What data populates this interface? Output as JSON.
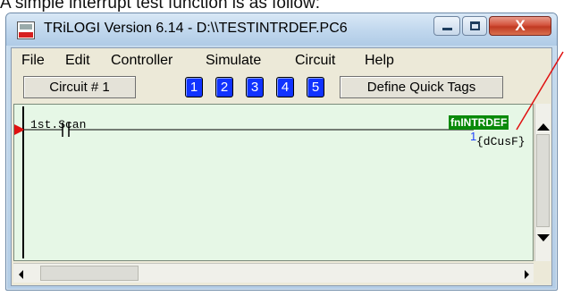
{
  "caption": "A simple interrupt test function is as follow:",
  "window": {
    "title": "TRiLOGI Version 6.14 - D:\\\\TESTINTRDEF.PC6",
    "minimize_icon": "minimize-icon",
    "maximize_icon": "maximize-icon",
    "close_icon": "close-icon",
    "close_glyph": "X"
  },
  "menu": {
    "items": [
      "File",
      "Edit",
      "Controller",
      "Simulate",
      "Circuit",
      "Help"
    ]
  },
  "toolbar": {
    "circuit_label": "Circuit # 1",
    "number_buttons": [
      "1",
      "2",
      "3",
      "4",
      "5"
    ],
    "define_label": "Define Quick Tags"
  },
  "ladder": {
    "contact_label": "1st.Scan",
    "function_name": "fnINTRDEF",
    "function_number": "1",
    "function_arg": "{dCusF}"
  },
  "colors": {
    "canvas_bg": "#e6f7e6",
    "number_button_bg": "#1133ff",
    "function_label_bg": "#0a8a0a",
    "rung_marker": "#e01010",
    "annotation_line": "#e01010"
  }
}
